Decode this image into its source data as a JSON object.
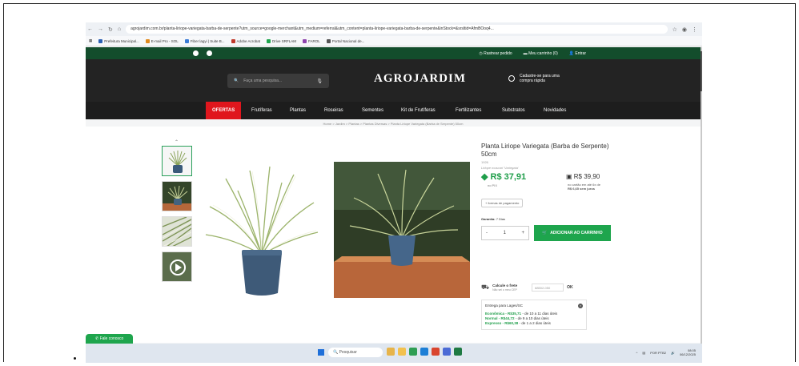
{
  "browser": {
    "url": "agrojardim.com.br/planta-liriope-variegata-barba-de-serpente?utm_source=google-merchant&utm_medium=referral&utm_content=planta-liriope-variegata-barba-de-serpente&inStock=&srsltid=AfmBOoq4..."
  },
  "bookmarks": [
    {
      "label": "Prefeitura Municipal...",
      "color": "#2b5fb3"
    },
    {
      "label": "E-mail Pro - SOL",
      "color": "#e08a1e"
    },
    {
      "label": "Fiber lagyi | Suite B...",
      "color": "#3a7bd5"
    },
    {
      "label": "Adobe Acrobat",
      "color": "#c0392b"
    },
    {
      "label": "Drive SRFLAM",
      "color": "#1ea54d"
    },
    {
      "label": "FAROL",
      "color": "#8e44ad"
    },
    {
      "label": "Portal Nacional de...",
      "color": "#555555"
    }
  ],
  "topbar": {
    "track": "Rastrear pedido",
    "cart": "Meu carrinho (0)",
    "login": "Entrar"
  },
  "header": {
    "search_placeholder": "Faça uma pesquisa...",
    "logo": "AGROJARDIM",
    "login_line1": "Cadastre-se para uma",
    "login_line2": "compra rápida"
  },
  "menu": [
    "OFERTAS",
    "Frutíferas",
    "Plantas",
    "Roseiras",
    "Sementes",
    "Kit de Frutíferas",
    "Fertilizantes",
    "Substratos",
    "Novidades"
  ],
  "breadcrumb": "Home > Jardim > Plantas > Plantas Diversas > Planta Liriope Variegata (Barba de Serpente) 50cm",
  "product": {
    "title": "Planta Liriope Variegata (Barba de Serpente) 50cm",
    "sku": "1926",
    "latin": "Liriope muscari 'Variegata'",
    "pix_price": "R$ 37,91",
    "pix_label": "no PIX",
    "card_price": "R$ 39,90",
    "card_sub_line1": "no cartão em até 6x de",
    "card_sub_line2": "R$ 6,65 sem juros",
    "payment_forms": "+ formas de pagamento",
    "guarantee_label": "Garantia:",
    "guarantee_value": "7 Dias",
    "qty": "1",
    "qty_minus": "-",
    "qty_plus": "+",
    "add_to_cart": "ADICIONAR AO CARRINHO"
  },
  "shipping": {
    "title": "Calcule o frete",
    "subtitle": "Não sei o meu CEP",
    "cep_placeholder": "88502-050",
    "ok": "OK",
    "delivery_to": "Entrega para Lages/SC",
    "options": [
      {
        "name": "Econômica",
        "price": "R$35,71",
        "time": "de 10 a 11 dias úteis"
      },
      {
        "name": "Normal",
        "price": "R$44,72",
        "time": "de 9 a 10 dias úteis"
      },
      {
        "name": "Expresso",
        "price": "R$60,38",
        "time": "de 1 a 2 dias úteis"
      }
    ]
  },
  "chat": "Fale conosco",
  "taskbar": {
    "search": "Pesquisar",
    "lang": "POR PTB2",
    "time": "08:05",
    "date": "06/12/2025"
  }
}
